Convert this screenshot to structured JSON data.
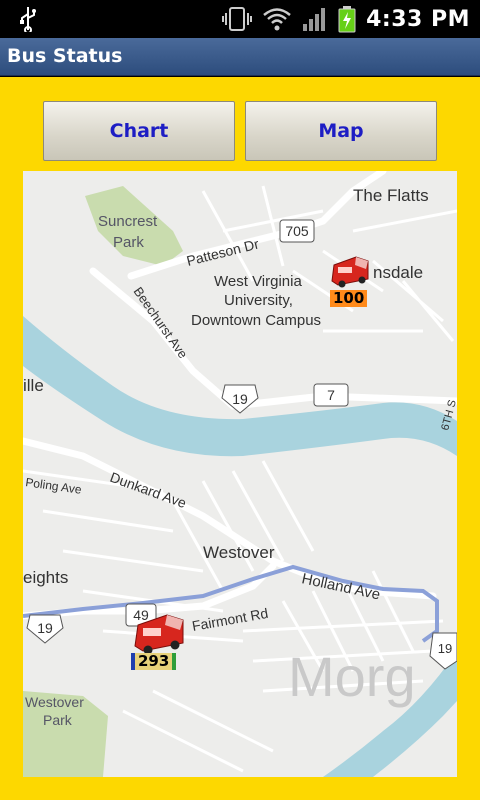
{
  "status_bar": {
    "time": "4:33 PM",
    "icons": [
      "usb-icon",
      "vibrate-icon",
      "wifi-icon",
      "signal-icon",
      "battery-charging-icon"
    ]
  },
  "title_bar": {
    "title": "Bus Status"
  },
  "buttons": {
    "chart_label": "Chart",
    "map_label": "Map"
  },
  "map": {
    "labels": {
      "the_flatts": "The Flatts",
      "suncrest_park_1": "Suncrest",
      "suncrest_park_2": "Park",
      "patteson_dr": "Patteson Dr",
      "route_705": "705",
      "ansdale": "nsdale",
      "wvu_1": "West Virginia",
      "wvu_2": "University,",
      "wvu_3": "Downtown Campus",
      "beechurst_ave": "Beechurst Ave",
      "ille": "ille",
      "route_19_top": "19",
      "route_7": "7",
      "sixth_st": "6TH S",
      "poling_ave": "Poling Ave",
      "dunkard_ave": "Dunkard Ave",
      "westover": "Westover",
      "eights": "eights",
      "fairmont_rd": "Fairmont Rd",
      "holland_ave": "Holland Ave",
      "route_49": "49",
      "route_19_bottom": "19",
      "route_19_right": "19",
      "westover_park_1": "Westover",
      "westover_park_2": "Park",
      "morg": "Morg"
    },
    "buses": [
      {
        "route": "100",
        "label_color": "#ff8a1a"
      },
      {
        "route": "293",
        "label_color": "#e8d27a"
      }
    ]
  },
  "colors": {
    "background": "#fdd800",
    "river": "#a9d3de",
    "road": "#ffffff",
    "park": "#c9dcae",
    "accent": "#1d1dc4"
  }
}
